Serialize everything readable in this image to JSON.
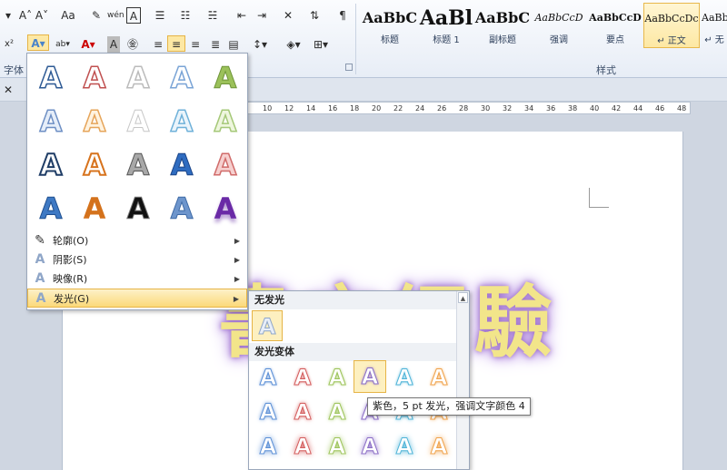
{
  "ribbon": {
    "font_group_label": "字体",
    "styles_group_label": "样式",
    "styles": [
      {
        "sample": "AaBbC",
        "name": "标题"
      },
      {
        "sample": "AaBl",
        "name": "标题 1"
      },
      {
        "sample": "AaBbC",
        "name": "副标题"
      },
      {
        "sample": "AaBbCcD",
        "name": "强调"
      },
      {
        "sample": "AaBbCcD",
        "name": "要点"
      },
      {
        "sample": "AaBbCcDc",
        "name": "↵ 正文"
      },
      {
        "sample": "AaBbCc",
        "name": "↵ 无"
      }
    ],
    "icons": {
      "font_size_up": "A˄",
      "font_size_down": "A˅",
      "change_case": "Aa",
      "phonetic": "wén",
      "char_border": "A",
      "superscript": "x²"
    }
  },
  "ruler": {
    "ticks": [
      "10",
      "12",
      "14",
      "16",
      "18",
      "20",
      "22",
      "24",
      "26",
      "28",
      "30",
      "32",
      "34",
      "36",
      "38",
      "40",
      "42",
      "44",
      "46",
      "48"
    ]
  },
  "document": {
    "text": "書亦經驗"
  },
  "effects_menu": {
    "letter": "A",
    "items": [
      {
        "label": "轮廓(O)"
      },
      {
        "label": "阴影(S)"
      },
      {
        "label": "映像(R)"
      },
      {
        "label": "发光(G)"
      }
    ]
  },
  "glow_menu": {
    "no_glow_header": "无发光",
    "variants_header": "发光变体",
    "letter": "A",
    "colors": [
      "#5b8fd6",
      "#d45d5d",
      "#9dc45a",
      "#8a6cc6",
      "#4fb4d8",
      "#f0a24a"
    ]
  },
  "tooltip": {
    "text": "紫色，5 pt 发光，强调文字颜色 4"
  }
}
